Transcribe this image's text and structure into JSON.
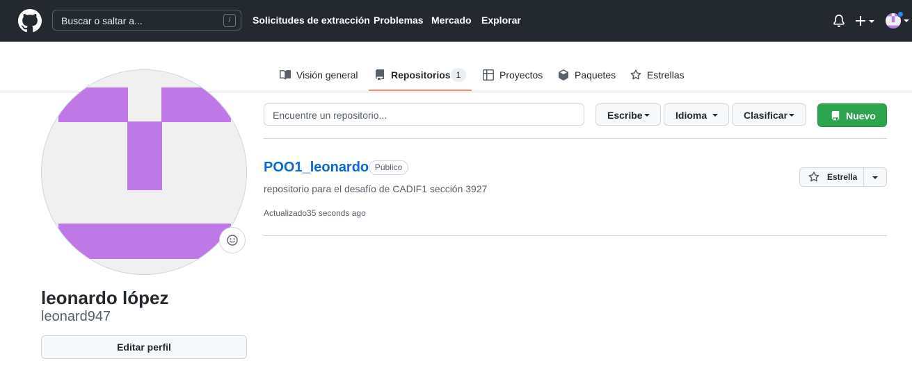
{
  "header": {
    "search_placeholder": "Buscar o saltar a...",
    "search_shortcut": "/",
    "nav": [
      "Solicitudes de extracción",
      "Problemas",
      "Mercado",
      "Explorar"
    ]
  },
  "tabs": [
    {
      "label": "Visión general",
      "icon": "book-icon"
    },
    {
      "label": "Repositorios",
      "icon": "repo-icon",
      "counter": "1",
      "active": true
    },
    {
      "label": "Proyectos",
      "icon": "table-icon"
    },
    {
      "label": "Paquetes",
      "icon": "package-icon"
    },
    {
      "label": "Estrellas",
      "icon": "star-icon"
    }
  ],
  "profile": {
    "full_name": "leonardo lópez",
    "login": "leonard947",
    "edit_label": "Editar perfil",
    "avatar_color": "#bf79e6"
  },
  "filters": {
    "search_placeholder": "Encuentre un repositorio...",
    "type_label": "Escribe",
    "language_label": "Idioma",
    "sort_label": "Clasificar",
    "new_label": "Nuevo"
  },
  "repos": [
    {
      "name": "POO1_leonardo",
      "visibility": "Público",
      "description": "repositorio para el desafío de CADIF1 sección 3927",
      "updated": "Actualizado35 seconds ago",
      "star_label": "Estrella"
    }
  ],
  "colors": {
    "header_bg": "#24292f",
    "link": "#0969da",
    "primary_button": "#2da44e",
    "active_tab_underline": "#fd8c73"
  }
}
